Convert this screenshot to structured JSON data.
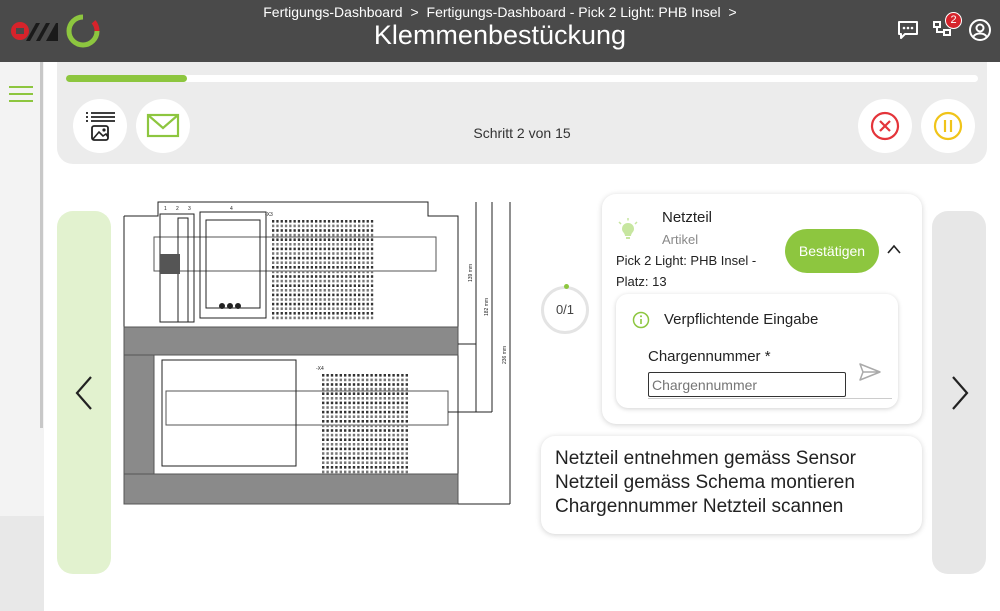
{
  "header": {
    "breadcrumbs": [
      "Fertigungs-Dashboard",
      ">",
      "Fertigungs-Dashboard - Pick 2 Light: PHB Insel",
      ">"
    ],
    "title": "Klemmenbestückung",
    "notification_count": "2",
    "icons": [
      "chat-icon",
      "process-alert-icon",
      "user-account-icon"
    ]
  },
  "toolbar": {
    "progress_fraction": 0.133,
    "step_text": "Schritt 2 von 15"
  },
  "counter": {
    "text": "0/1"
  },
  "article_card": {
    "name": "Netzteil",
    "type": "Artikel",
    "location_line1": "Pick 2 Light: PHB Insel -",
    "location_line2": "Platz: 13",
    "confirm_label": "Bestätigen"
  },
  "input_card": {
    "heading": "Verpflichtende Eingabe",
    "label": "Chargennummer *",
    "placeholder": "Chargennummer"
  },
  "instructions": [
    "Netzteil entnehmen gemäss Sensor",
    "Netzteil gemäss Schema montieren",
    "Chargennummer Netzteil scannen"
  ],
  "drawing": {
    "labels": [
      "-X3",
      "-X4",
      "1",
      "2",
      "3",
      "4"
    ],
    "dimensions": [
      "139 mm",
      "182 mm",
      "236 mm"
    ]
  },
  "colors": {
    "accent": "#8dc63f",
    "topbar": "#4a4a4a",
    "cancel": "#e4343a",
    "pause": "#f0c419"
  }
}
